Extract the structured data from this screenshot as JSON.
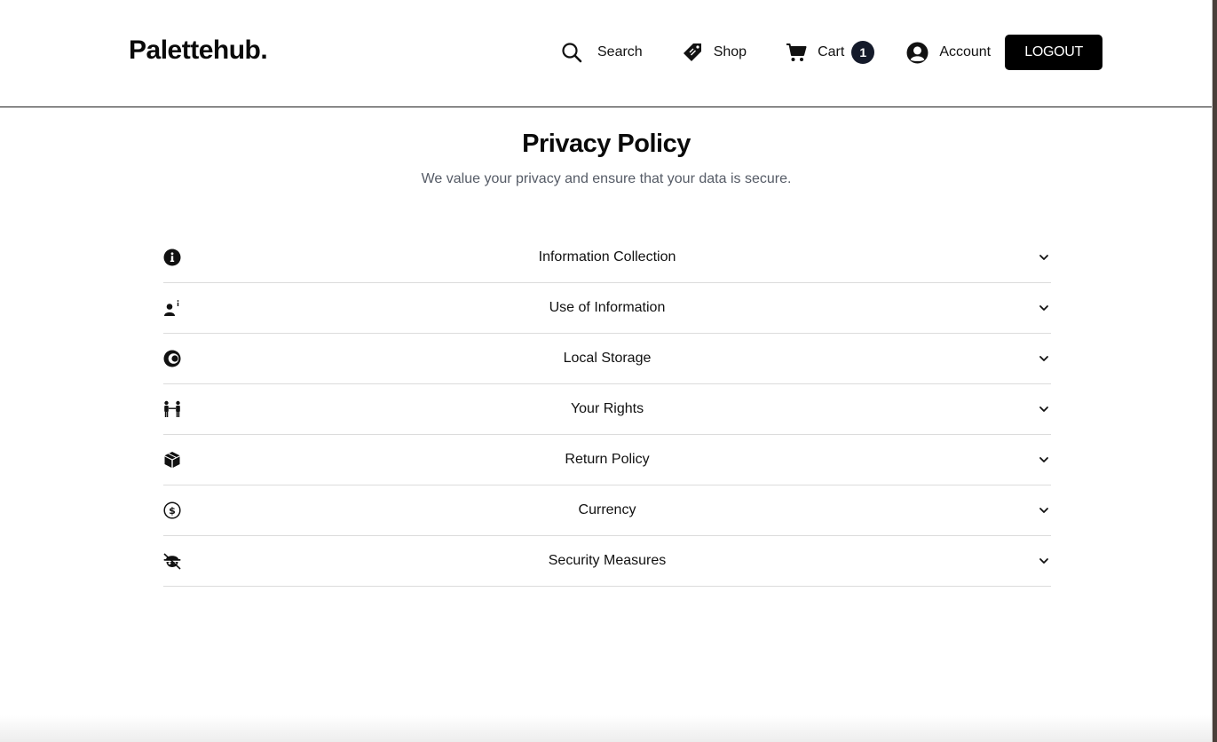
{
  "header": {
    "logo": "Palettehub.",
    "nav": {
      "search_label": "Search",
      "shop_label": "Shop",
      "cart_label": "Cart",
      "cart_count": "1",
      "account_label": "Account",
      "logout_label": "LOGOUT"
    }
  },
  "main": {
    "title": "Privacy Policy",
    "subtitle": "We value your privacy and ensure that your data is secure.",
    "sections": [
      {
        "label": "Information Collection",
        "icon": "info-circle-icon"
      },
      {
        "label": "Use of Information",
        "icon": "user-info-icon"
      },
      {
        "label": "Local Storage",
        "icon": "cookie-icon"
      },
      {
        "label": "Your Rights",
        "icon": "people-icon"
      },
      {
        "label": "Return Policy",
        "icon": "box-icon"
      },
      {
        "label": "Currency",
        "icon": "dollar-circle-icon"
      },
      {
        "label": "Security Measures",
        "icon": "user-secret-icon"
      }
    ]
  },
  "colors": {
    "badge_bg": "#141a2a",
    "button_bg": "#000000",
    "subtitle_text": "#555b66",
    "divider": "#dcdcdc"
  }
}
